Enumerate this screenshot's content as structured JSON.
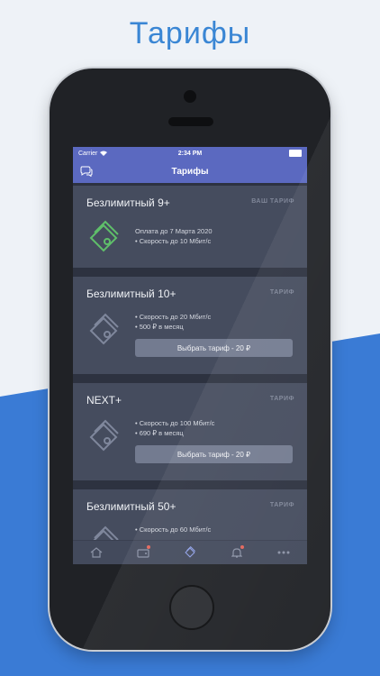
{
  "headline": "Тарифы",
  "status": {
    "carrier": "Carrier",
    "time": "2:34 PM"
  },
  "nav": {
    "title": "Тарифы"
  },
  "cards": [
    {
      "title": "Безлимитный 9+",
      "tag": "ВАШ ТАРИФ",
      "lines": [
        "Оплата до 7 Марта 2020",
        "• Скорость до 10 Мбит/с"
      ],
      "button": "",
      "active": true
    },
    {
      "title": "Безлимитный 10+",
      "tag": "ТАРИФ",
      "lines": [
        "• Скорость до 20 Мбит/с",
        "• 500 ₽ в месяц"
      ],
      "button": "Выбрать тариф - 20 ₽",
      "active": false
    },
    {
      "title": "NEXT+",
      "tag": "ТАРИФ",
      "lines": [
        "• Скорость до 100 Мбит/с",
        "• 690 ₽ в месяц"
      ],
      "button": "Выбрать тариф - 20 ₽",
      "active": false
    },
    {
      "title": "Безлимитный 50+",
      "tag": "ТАРИФ",
      "lines": [
        "• Скорость до 60 Мбит/с"
      ],
      "button": "",
      "active": false
    }
  ],
  "colors": {
    "accent": "#5b69c0",
    "active_icon": "#5fbf6a",
    "inactive_icon": "#7f879c",
    "notification": "#e4655a"
  }
}
